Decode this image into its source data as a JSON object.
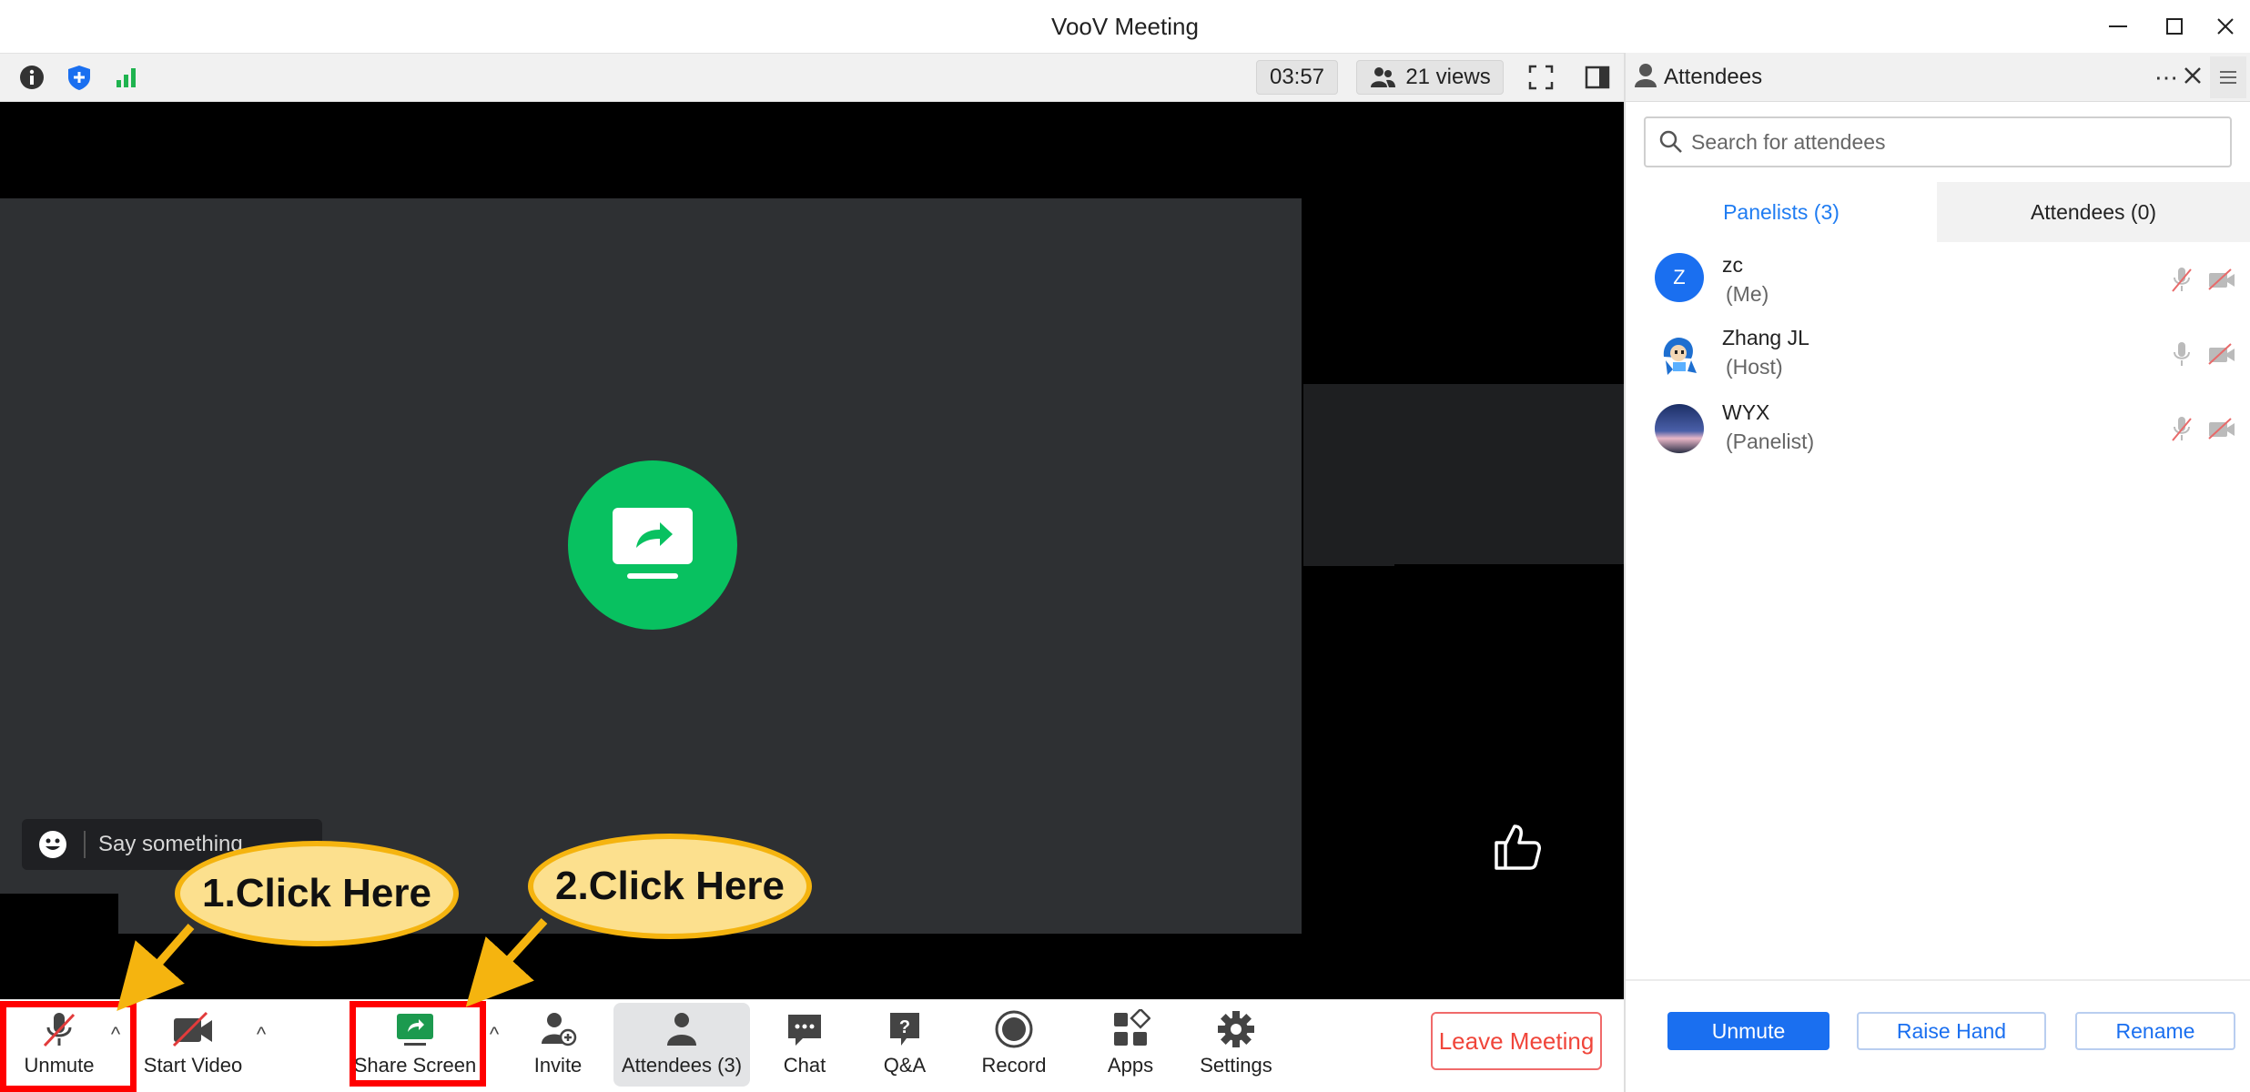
{
  "window": {
    "title": "VooV Meeting"
  },
  "topbar": {
    "timer": "03:57",
    "views": "21 views"
  },
  "stage": {
    "chat_placeholder": "Say something"
  },
  "toolbar": {
    "unmute": "Unmute",
    "start_video": "Start Video",
    "share_screen": "Share Screen",
    "invite": "Invite",
    "attendees": "Attendees (3)",
    "chat": "Chat",
    "qa": "Q&A",
    "record": "Record",
    "apps": "Apps",
    "settings": "Settings",
    "leave": "Leave Meeting"
  },
  "annotations": {
    "step1": "1.Click Here",
    "step2": "2.Click Here"
  },
  "panel": {
    "title": "Attendees",
    "search_placeholder": "Search for attendees",
    "tabs": {
      "panelists": "Panelists (3)",
      "attendees": "Attendees (0)"
    },
    "people": [
      {
        "name": "zc",
        "role": "(Me)",
        "avatar_letter": "Z"
      },
      {
        "name": "Zhang JL",
        "role": "(Host)"
      },
      {
        "name": "WYX",
        "role": "(Panelist)"
      }
    ],
    "buttons": {
      "unmute": "Unmute",
      "raise_hand": "Raise Hand",
      "rename": "Rename"
    }
  },
  "colors": {
    "accent": "#1a6ff0",
    "share_green": "#08c160",
    "leave_red": "#f0453a",
    "highlight_red": "#ff0000",
    "callout_fill": "#fce08e",
    "callout_border": "#f5b40f"
  }
}
